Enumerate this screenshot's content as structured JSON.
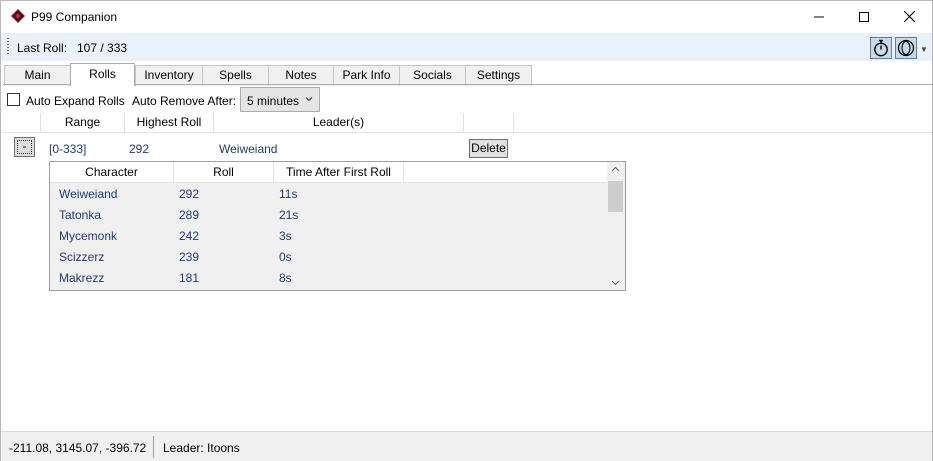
{
  "window": {
    "title": "P99 Companion",
    "minimize_glyph": "—",
    "maximize_glyph": "☐",
    "close_glyph": "✕"
  },
  "toolbar": {
    "last_roll_label": "Last Roll:",
    "last_roll_value": "107 / 333",
    "buttons": [
      "stopwatch-icon",
      "ring-icon"
    ]
  },
  "tabs": [
    {
      "label": "Main"
    },
    {
      "label": "Rolls",
      "active": true
    },
    {
      "label": "Inventory"
    },
    {
      "label": "Spells"
    },
    {
      "label": "Notes"
    },
    {
      "label": "Park Info"
    },
    {
      "label": "Socials"
    },
    {
      "label": "Settings"
    }
  ],
  "options": {
    "auto_expand_label": "Auto Expand Rolls",
    "auto_expand_checked": false,
    "auto_remove_label": "Auto Remove After:",
    "auto_remove_value": "5 minutes"
  },
  "rolls_grid": {
    "columns": [
      "Range",
      "Highest Roll",
      "Leader(s)"
    ],
    "row": {
      "collapse_label": "-",
      "range": "[0-333]",
      "highest_roll": "292",
      "leader": "Weiweiand",
      "delete_label": "Delete"
    }
  },
  "detail_grid": {
    "columns": [
      "Character",
      "Roll",
      "Time After First Roll"
    ],
    "rows": [
      {
        "character": "Weiweiand",
        "roll": "292",
        "time": "11s"
      },
      {
        "character": "Tatonka",
        "roll": "289",
        "time": "21s"
      },
      {
        "character": "Mycemonk",
        "roll": "242",
        "time": "3s"
      },
      {
        "character": "Scizzerz",
        "roll": "239",
        "time": "0s"
      },
      {
        "character": "Makrezz",
        "roll": "181",
        "time": "8s"
      }
    ]
  },
  "status": {
    "coords": "-211.08, 3145.07, -396.72",
    "leader": "Leader: Itoons"
  },
  "colors": {
    "toolstrip_bg": "#e9f1fa",
    "link_text": "#1f3a7a",
    "app_icon": "#7b1b22"
  }
}
